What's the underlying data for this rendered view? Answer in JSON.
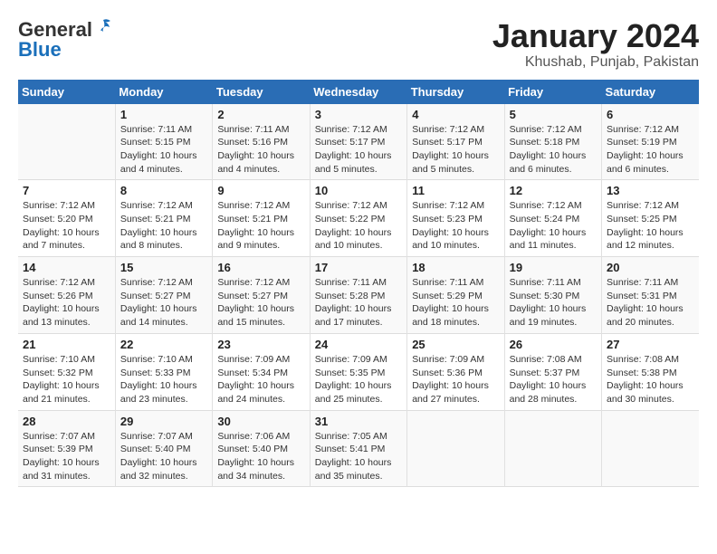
{
  "logo": {
    "general": "General",
    "blue": "Blue"
  },
  "title": "January 2024",
  "subtitle": "Khushab, Punjab, Pakistan",
  "headers": [
    "Sunday",
    "Monday",
    "Tuesday",
    "Wednesday",
    "Thursday",
    "Friday",
    "Saturday"
  ],
  "weeks": [
    [
      {
        "num": "",
        "info": ""
      },
      {
        "num": "1",
        "info": "Sunrise: 7:11 AM\nSunset: 5:15 PM\nDaylight: 10 hours\nand 4 minutes."
      },
      {
        "num": "2",
        "info": "Sunrise: 7:11 AM\nSunset: 5:16 PM\nDaylight: 10 hours\nand 4 minutes."
      },
      {
        "num": "3",
        "info": "Sunrise: 7:12 AM\nSunset: 5:17 PM\nDaylight: 10 hours\nand 5 minutes."
      },
      {
        "num": "4",
        "info": "Sunrise: 7:12 AM\nSunset: 5:17 PM\nDaylight: 10 hours\nand 5 minutes."
      },
      {
        "num": "5",
        "info": "Sunrise: 7:12 AM\nSunset: 5:18 PM\nDaylight: 10 hours\nand 6 minutes."
      },
      {
        "num": "6",
        "info": "Sunrise: 7:12 AM\nSunset: 5:19 PM\nDaylight: 10 hours\nand 6 minutes."
      }
    ],
    [
      {
        "num": "7",
        "info": "Sunrise: 7:12 AM\nSunset: 5:20 PM\nDaylight: 10 hours\nand 7 minutes."
      },
      {
        "num": "8",
        "info": "Sunrise: 7:12 AM\nSunset: 5:21 PM\nDaylight: 10 hours\nand 8 minutes."
      },
      {
        "num": "9",
        "info": "Sunrise: 7:12 AM\nSunset: 5:21 PM\nDaylight: 10 hours\nand 9 minutes."
      },
      {
        "num": "10",
        "info": "Sunrise: 7:12 AM\nSunset: 5:22 PM\nDaylight: 10 hours\nand 10 minutes."
      },
      {
        "num": "11",
        "info": "Sunrise: 7:12 AM\nSunset: 5:23 PM\nDaylight: 10 hours\nand 10 minutes."
      },
      {
        "num": "12",
        "info": "Sunrise: 7:12 AM\nSunset: 5:24 PM\nDaylight: 10 hours\nand 11 minutes."
      },
      {
        "num": "13",
        "info": "Sunrise: 7:12 AM\nSunset: 5:25 PM\nDaylight: 10 hours\nand 12 minutes."
      }
    ],
    [
      {
        "num": "14",
        "info": "Sunrise: 7:12 AM\nSunset: 5:26 PM\nDaylight: 10 hours\nand 13 minutes."
      },
      {
        "num": "15",
        "info": "Sunrise: 7:12 AM\nSunset: 5:27 PM\nDaylight: 10 hours\nand 14 minutes."
      },
      {
        "num": "16",
        "info": "Sunrise: 7:12 AM\nSunset: 5:27 PM\nDaylight: 10 hours\nand 15 minutes."
      },
      {
        "num": "17",
        "info": "Sunrise: 7:11 AM\nSunset: 5:28 PM\nDaylight: 10 hours\nand 17 minutes."
      },
      {
        "num": "18",
        "info": "Sunrise: 7:11 AM\nSunset: 5:29 PM\nDaylight: 10 hours\nand 18 minutes."
      },
      {
        "num": "19",
        "info": "Sunrise: 7:11 AM\nSunset: 5:30 PM\nDaylight: 10 hours\nand 19 minutes."
      },
      {
        "num": "20",
        "info": "Sunrise: 7:11 AM\nSunset: 5:31 PM\nDaylight: 10 hours\nand 20 minutes."
      }
    ],
    [
      {
        "num": "21",
        "info": "Sunrise: 7:10 AM\nSunset: 5:32 PM\nDaylight: 10 hours\nand 21 minutes."
      },
      {
        "num": "22",
        "info": "Sunrise: 7:10 AM\nSunset: 5:33 PM\nDaylight: 10 hours\nand 23 minutes."
      },
      {
        "num": "23",
        "info": "Sunrise: 7:09 AM\nSunset: 5:34 PM\nDaylight: 10 hours\nand 24 minutes."
      },
      {
        "num": "24",
        "info": "Sunrise: 7:09 AM\nSunset: 5:35 PM\nDaylight: 10 hours\nand 25 minutes."
      },
      {
        "num": "25",
        "info": "Sunrise: 7:09 AM\nSunset: 5:36 PM\nDaylight: 10 hours\nand 27 minutes."
      },
      {
        "num": "26",
        "info": "Sunrise: 7:08 AM\nSunset: 5:37 PM\nDaylight: 10 hours\nand 28 minutes."
      },
      {
        "num": "27",
        "info": "Sunrise: 7:08 AM\nSunset: 5:38 PM\nDaylight: 10 hours\nand 30 minutes."
      }
    ],
    [
      {
        "num": "28",
        "info": "Sunrise: 7:07 AM\nSunset: 5:39 PM\nDaylight: 10 hours\nand 31 minutes."
      },
      {
        "num": "29",
        "info": "Sunrise: 7:07 AM\nSunset: 5:40 PM\nDaylight: 10 hours\nand 32 minutes."
      },
      {
        "num": "30",
        "info": "Sunrise: 7:06 AM\nSunset: 5:40 PM\nDaylight: 10 hours\nand 34 minutes."
      },
      {
        "num": "31",
        "info": "Sunrise: 7:05 AM\nSunset: 5:41 PM\nDaylight: 10 hours\nand 35 minutes."
      },
      {
        "num": "",
        "info": ""
      },
      {
        "num": "",
        "info": ""
      },
      {
        "num": "",
        "info": ""
      }
    ]
  ]
}
